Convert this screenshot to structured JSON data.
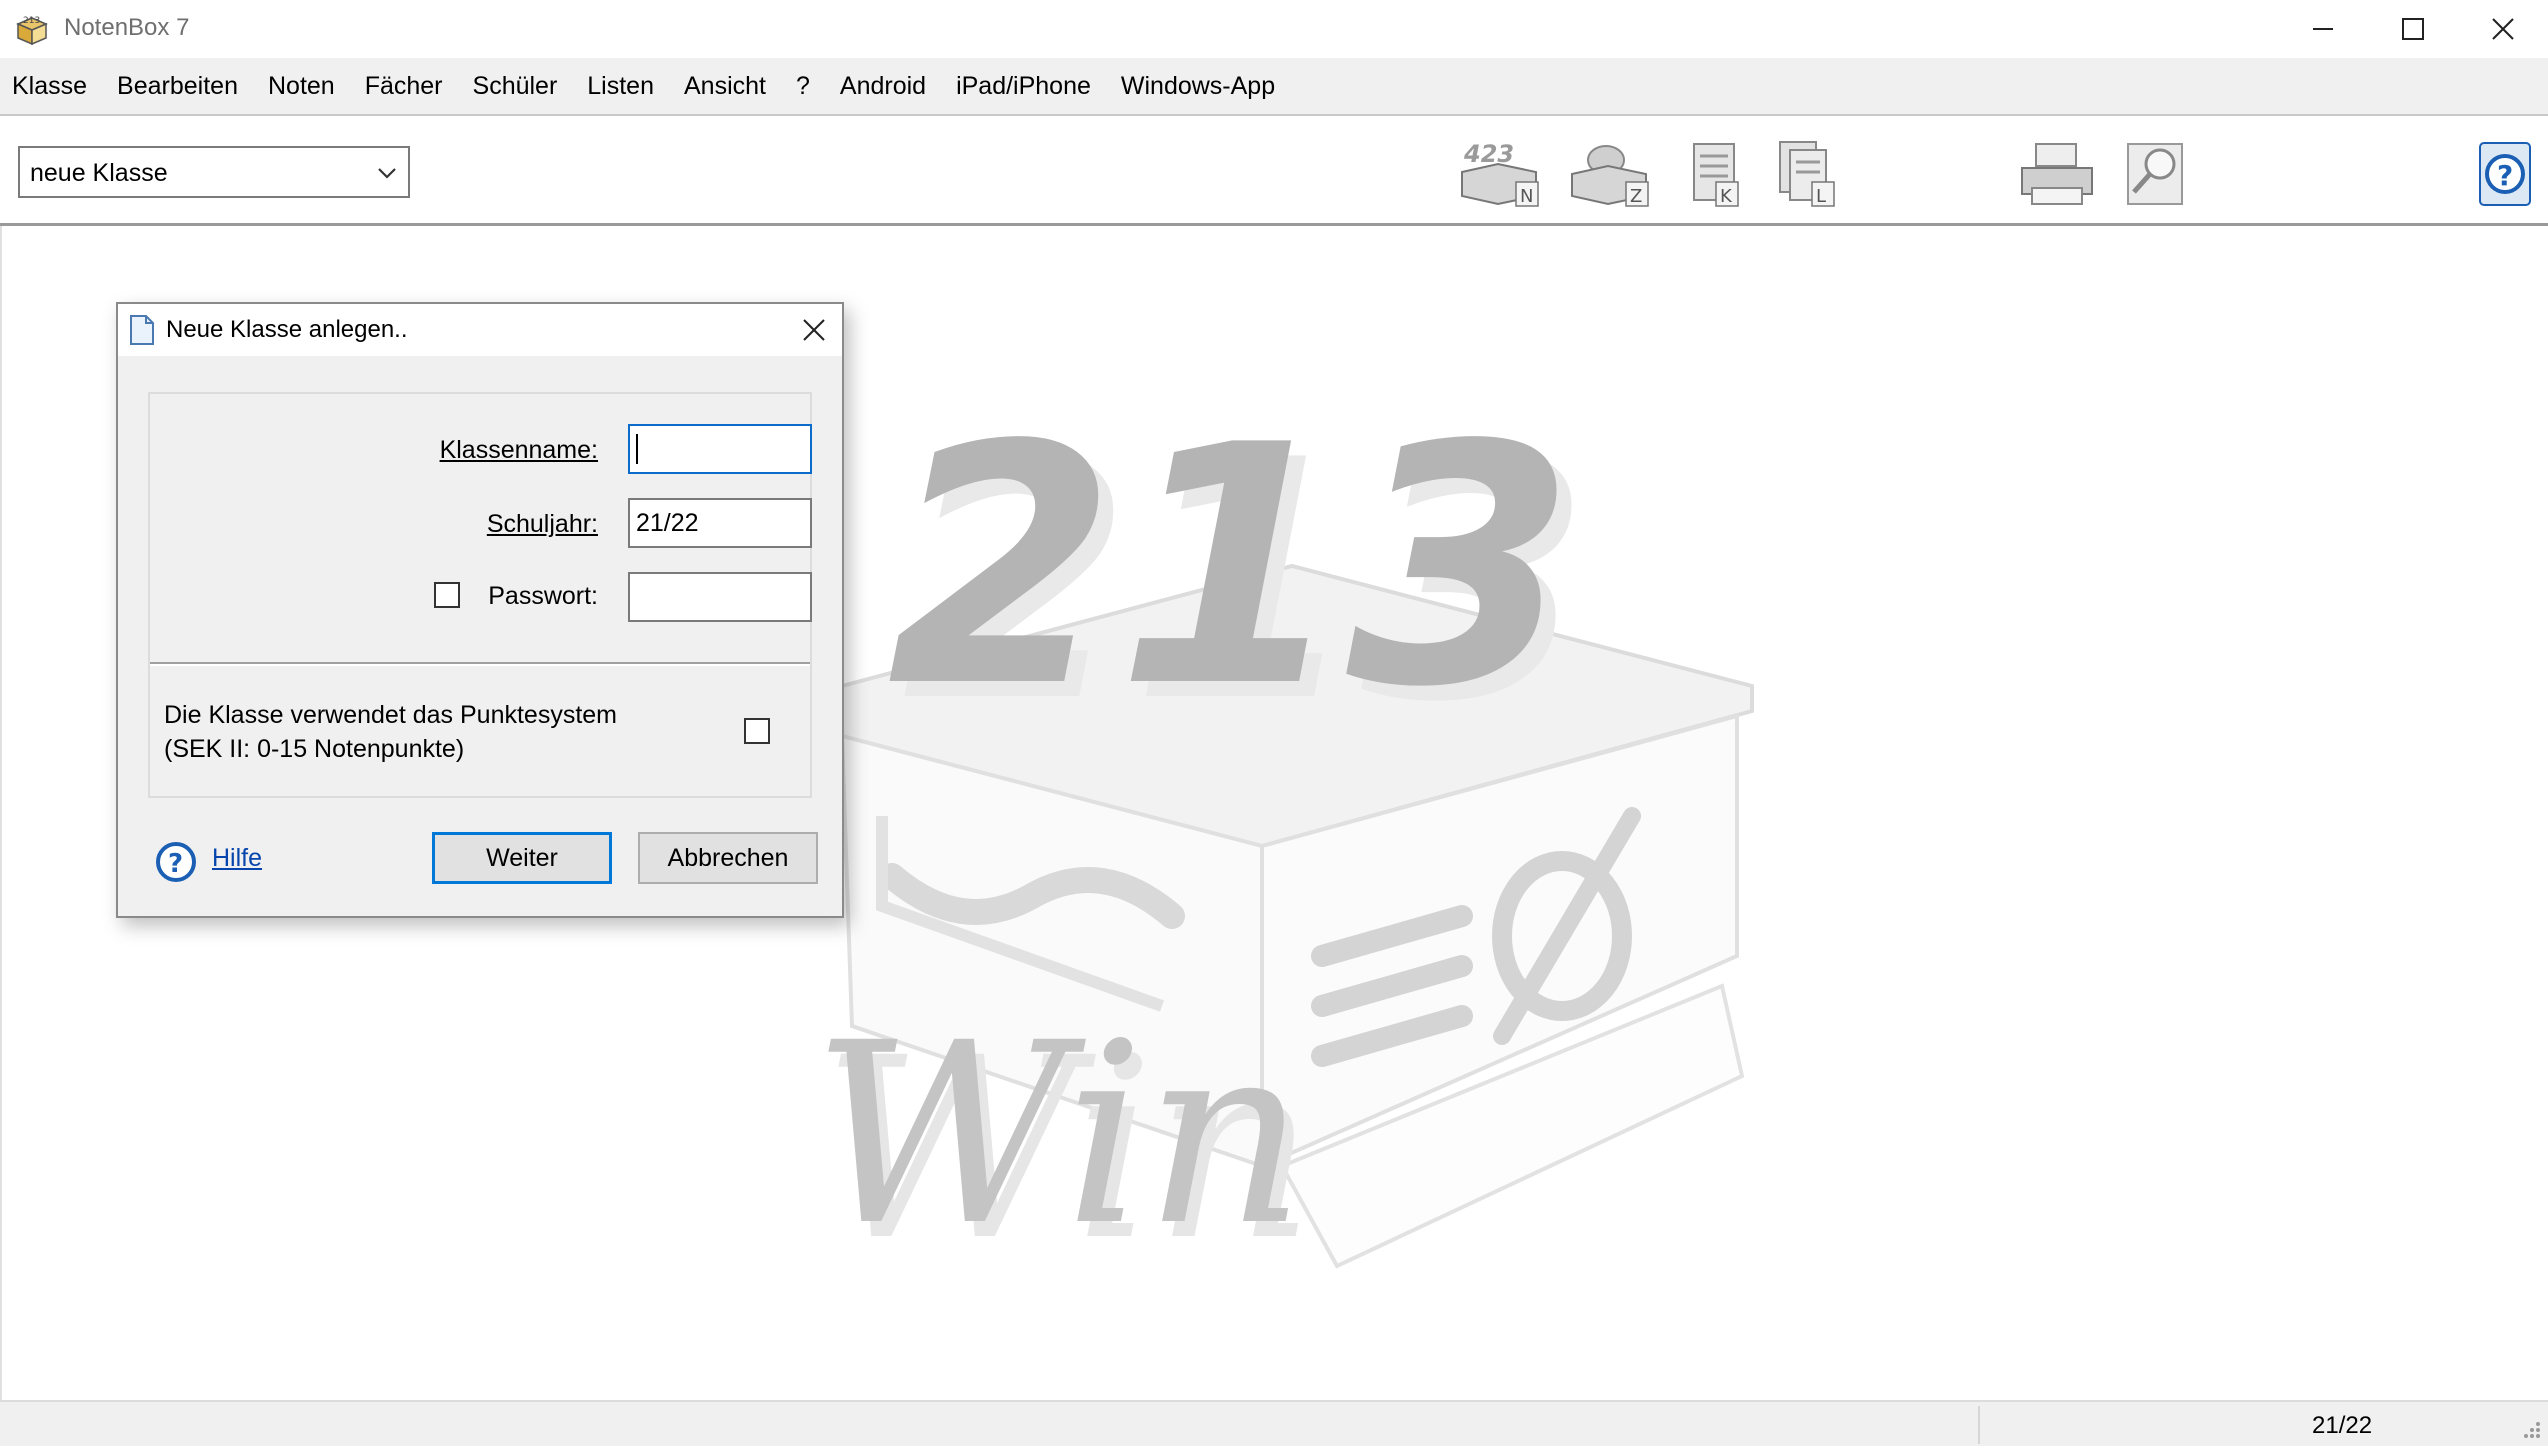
{
  "window": {
    "title": "NotenBox 7"
  },
  "menu": [
    {
      "label": "Klasse"
    },
    {
      "label": "Bearbeiten"
    },
    {
      "label": "Noten"
    },
    {
      "label": "Fächer"
    },
    {
      "label": "Schüler"
    },
    {
      "label": "Listen"
    },
    {
      "label": "Ansicht"
    },
    {
      "label": "?"
    },
    {
      "label": "Android"
    },
    {
      "label": "iPad/iPhone"
    },
    {
      "label": "Windows-App"
    }
  ],
  "toolbar": {
    "class_select_value": "neue Klasse",
    "icons": [
      "grades-entry-icon",
      "certificate-icon",
      "class-list-icon",
      "lists-icon",
      "printer-icon",
      "preview-magnifier-icon",
      "help-icon"
    ]
  },
  "watermark": {
    "numbers": "213",
    "text": "Win"
  },
  "dialog": {
    "title": "Neue Klasse anlegen..",
    "klassenname_label": "Klassenname:",
    "klassenname_value": "",
    "schuljahr_label": "Schuljahr:",
    "schuljahr_value": "21/22",
    "passwort_label": "Passwort:",
    "passwort_value": "",
    "passwort_checked": false,
    "punktesystem_line1": "Die Klasse verwendet das Punktesystem",
    "punktesystem_line2": "(SEK II: 0-15 Notenpunkte)",
    "punktesystem_checked": false,
    "help_label": "Hilfe",
    "next_label": "Weiter",
    "cancel_label": "Abbrechen"
  },
  "statusbar": {
    "school_year": "21/22"
  },
  "colors": {
    "menu_bg": "#f0f0f0",
    "focus_border": "#0b6cc9",
    "default_button_border": "#0078d7",
    "link": "#0645ad",
    "help_icon": "#1a5fb4"
  }
}
